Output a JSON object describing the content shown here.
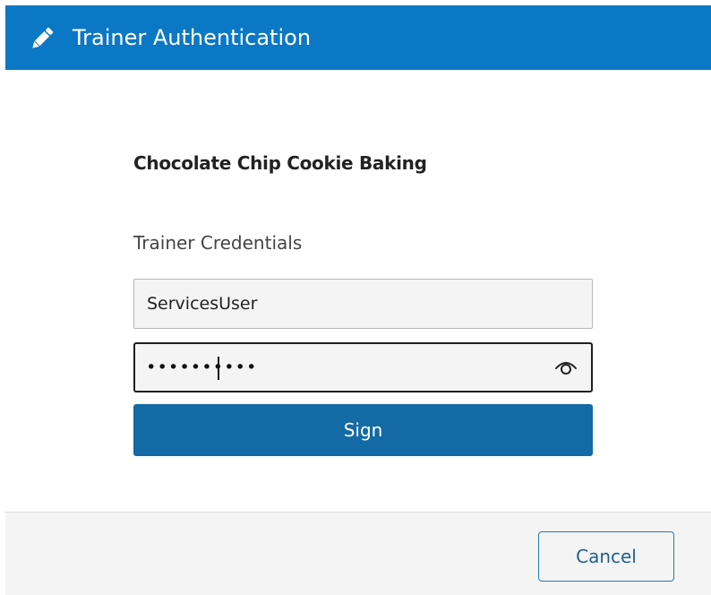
{
  "header": {
    "title": "Trainer Authentication",
    "icon": "pencil-icon",
    "background_color": "#0b78c5"
  },
  "main": {
    "course_title": "Chocolate Chip Cookie Baking",
    "credentials_label": "Trainer Credentials",
    "username": {
      "value": "ServicesUser"
    },
    "password": {
      "masked_value": "••••••••••",
      "toggle_icon": "eye-icon"
    },
    "sign_button_label": "Sign",
    "sign_button_color": "#136aa4"
  },
  "footer": {
    "cancel_label": "Cancel"
  }
}
